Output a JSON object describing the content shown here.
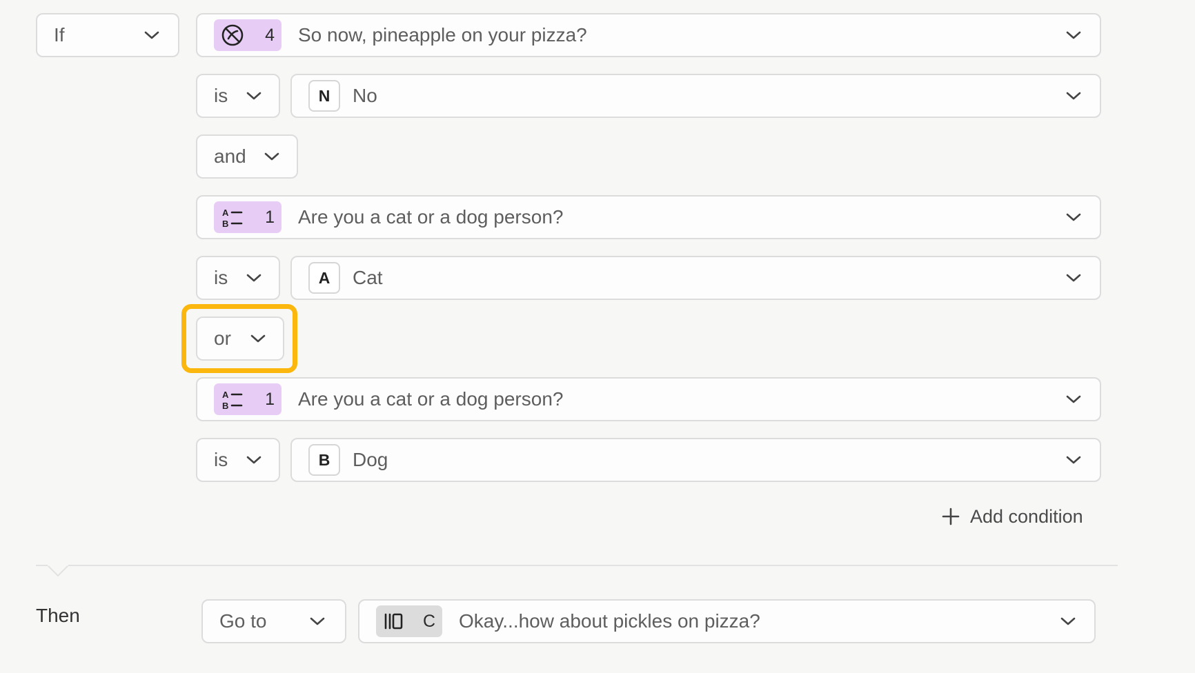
{
  "if_select": {
    "label": "If"
  },
  "groups": [
    {
      "question": {
        "icon": "opinion-scale-icon",
        "number": "4",
        "text": "So now, pineapple on your pizza?"
      },
      "operator": "is",
      "answer": {
        "letter": "N",
        "text": "No"
      },
      "joiner": "and"
    },
    {
      "question": {
        "icon": "multiple-choice-icon",
        "number": "1",
        "text": "Are you a cat or a dog person?"
      },
      "operator": "is",
      "answer": {
        "letter": "A",
        "text": "Cat"
      },
      "joiner": "or"
    },
    {
      "question": {
        "icon": "multiple-choice-icon",
        "number": "1",
        "text": "Are you a cat or a dog person?"
      },
      "operator": "is",
      "answer": {
        "letter": "B",
        "text": "Dog"
      }
    }
  ],
  "add_condition": {
    "label": "Add condition",
    "icon": "plus-icon"
  },
  "then": {
    "label": "Then",
    "action": "Go to",
    "target": {
      "icon": "statement-icon",
      "letter": "C",
      "text": "Okay...how about pickles on pizza?"
    }
  },
  "colors": {
    "question_badge": "#e7cdf5",
    "target_badge": "#dcdcdc",
    "highlight": "#fbb70d",
    "background": "#f7f7f6"
  }
}
